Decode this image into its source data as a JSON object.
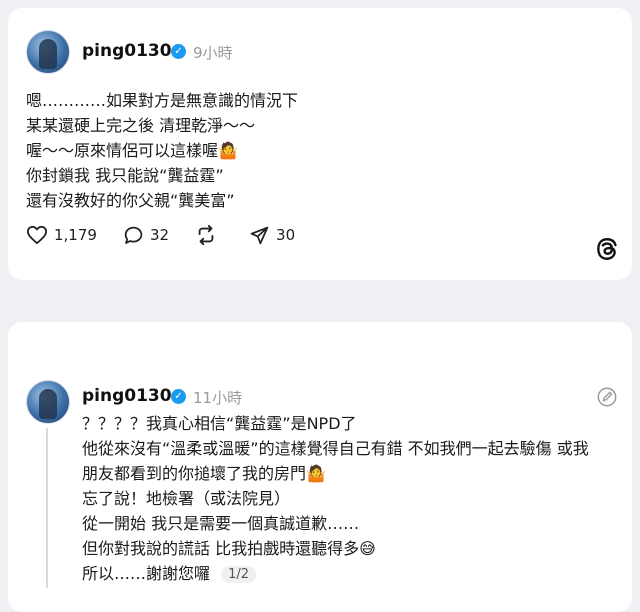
{
  "post1": {
    "username": "ping0130",
    "time": "9小時",
    "lines": [
      "嗯…………如果對方是無意識的情況下",
      "某某還硬上完之後 清理乾淨～～",
      "喔～～原來情侶可以這樣喔",
      "你封鎖我 我只能說“龔益霆”",
      "還有沒教好的你父親“龔美富”"
    ],
    "line3_emoji": "🤷",
    "likes": "1,179",
    "comments": "32",
    "shares": "30"
  },
  "post2": {
    "username": "ping0130",
    "time": "11小時",
    "lines": [
      "？？？？我真心相信“龔益霆”是NPD了",
      "他從來沒有“溫柔或溫暖”的這樣覺得自己有錯 不如我們一起去驗傷 或我",
      "朋友都看到的你搥壞了我的房門",
      "忘了說！地檢署（或法院見）",
      "從一開始 我只是需要一個真誠道歉……",
      "但你對我說的謊話 比我拍戲時還聽得多",
      "所以……謝謝您囉"
    ],
    "line3_emoji": "🤷",
    "line6_emoji": "😅",
    "pager": "1/2"
  },
  "icons": {
    "verified": "verified-check-icon",
    "like": "heart-icon",
    "comment": "comment-bubble-icon",
    "repost": "repost-icon",
    "share": "send-icon",
    "brand": "threads-logo-icon",
    "edit": "edit-icon"
  },
  "colors": {
    "verified": "#1d9bf0",
    "background": "#eef0f3"
  }
}
